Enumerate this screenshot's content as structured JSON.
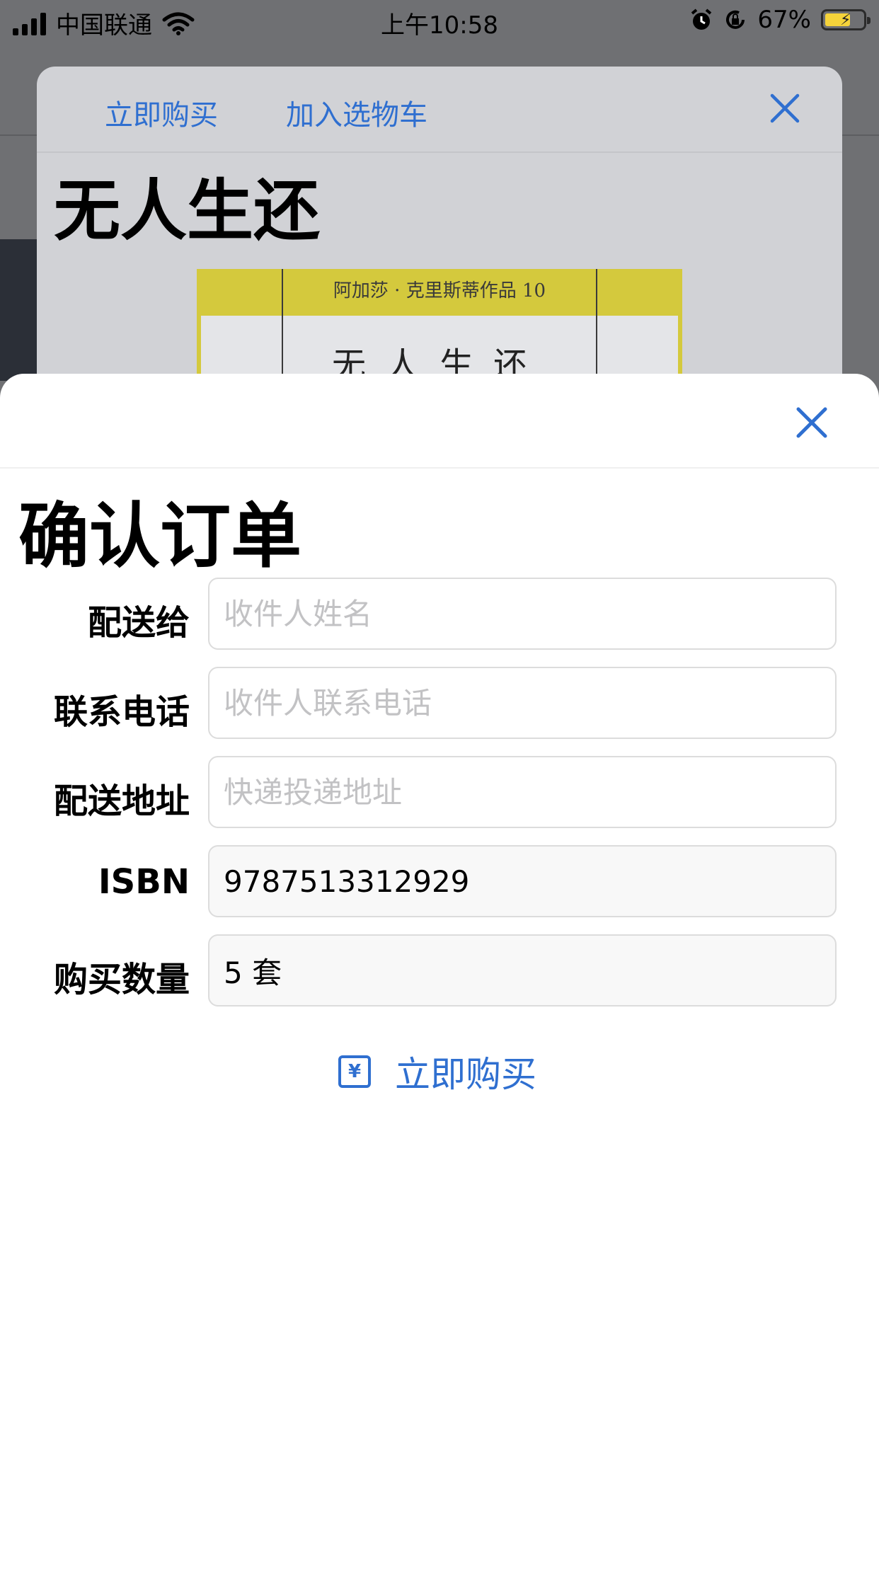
{
  "status_bar": {
    "carrier": "中国联通",
    "time": "上午10:58",
    "battery_percent": "67%",
    "battery_level": 0.67,
    "icons": [
      "signal-icon",
      "wifi-icon",
      "alarm-icon",
      "rotation-lock-icon",
      "battery-charging-icon"
    ]
  },
  "product_sheet": {
    "buy_now_label": "立即购买",
    "add_to_cart_label": "加入选物车",
    "close_icon": "close-icon",
    "title": "无人生还",
    "cover": {
      "series": "阿加莎 · 克里斯蒂作品 10",
      "name": "无人生还",
      "colors": {
        "band": "#d4c93d",
        "paper": "#e4e5e8"
      }
    }
  },
  "order_sheet": {
    "close_icon": "close-icon",
    "title": "确认订单",
    "fields": [
      {
        "label": "配送给",
        "placeholder": "收件人姓名",
        "value": ""
      },
      {
        "label": "联系电话",
        "placeholder": "收件人联系电话",
        "value": ""
      },
      {
        "label": "配送地址",
        "placeholder": "快递投递地址",
        "value": ""
      },
      {
        "label": "ISBN",
        "placeholder": "",
        "value": "9787513312929"
      },
      {
        "label": "购买数量",
        "placeholder": "",
        "value": "5 套"
      }
    ],
    "buy_button": {
      "label": "立即购买",
      "icon": "yen-icon",
      "icon_glyph": "¥"
    }
  },
  "colors": {
    "accent": "#2f6fd0",
    "backdrop": "#6f7073",
    "back_sheet": "#d1d2d6"
  }
}
